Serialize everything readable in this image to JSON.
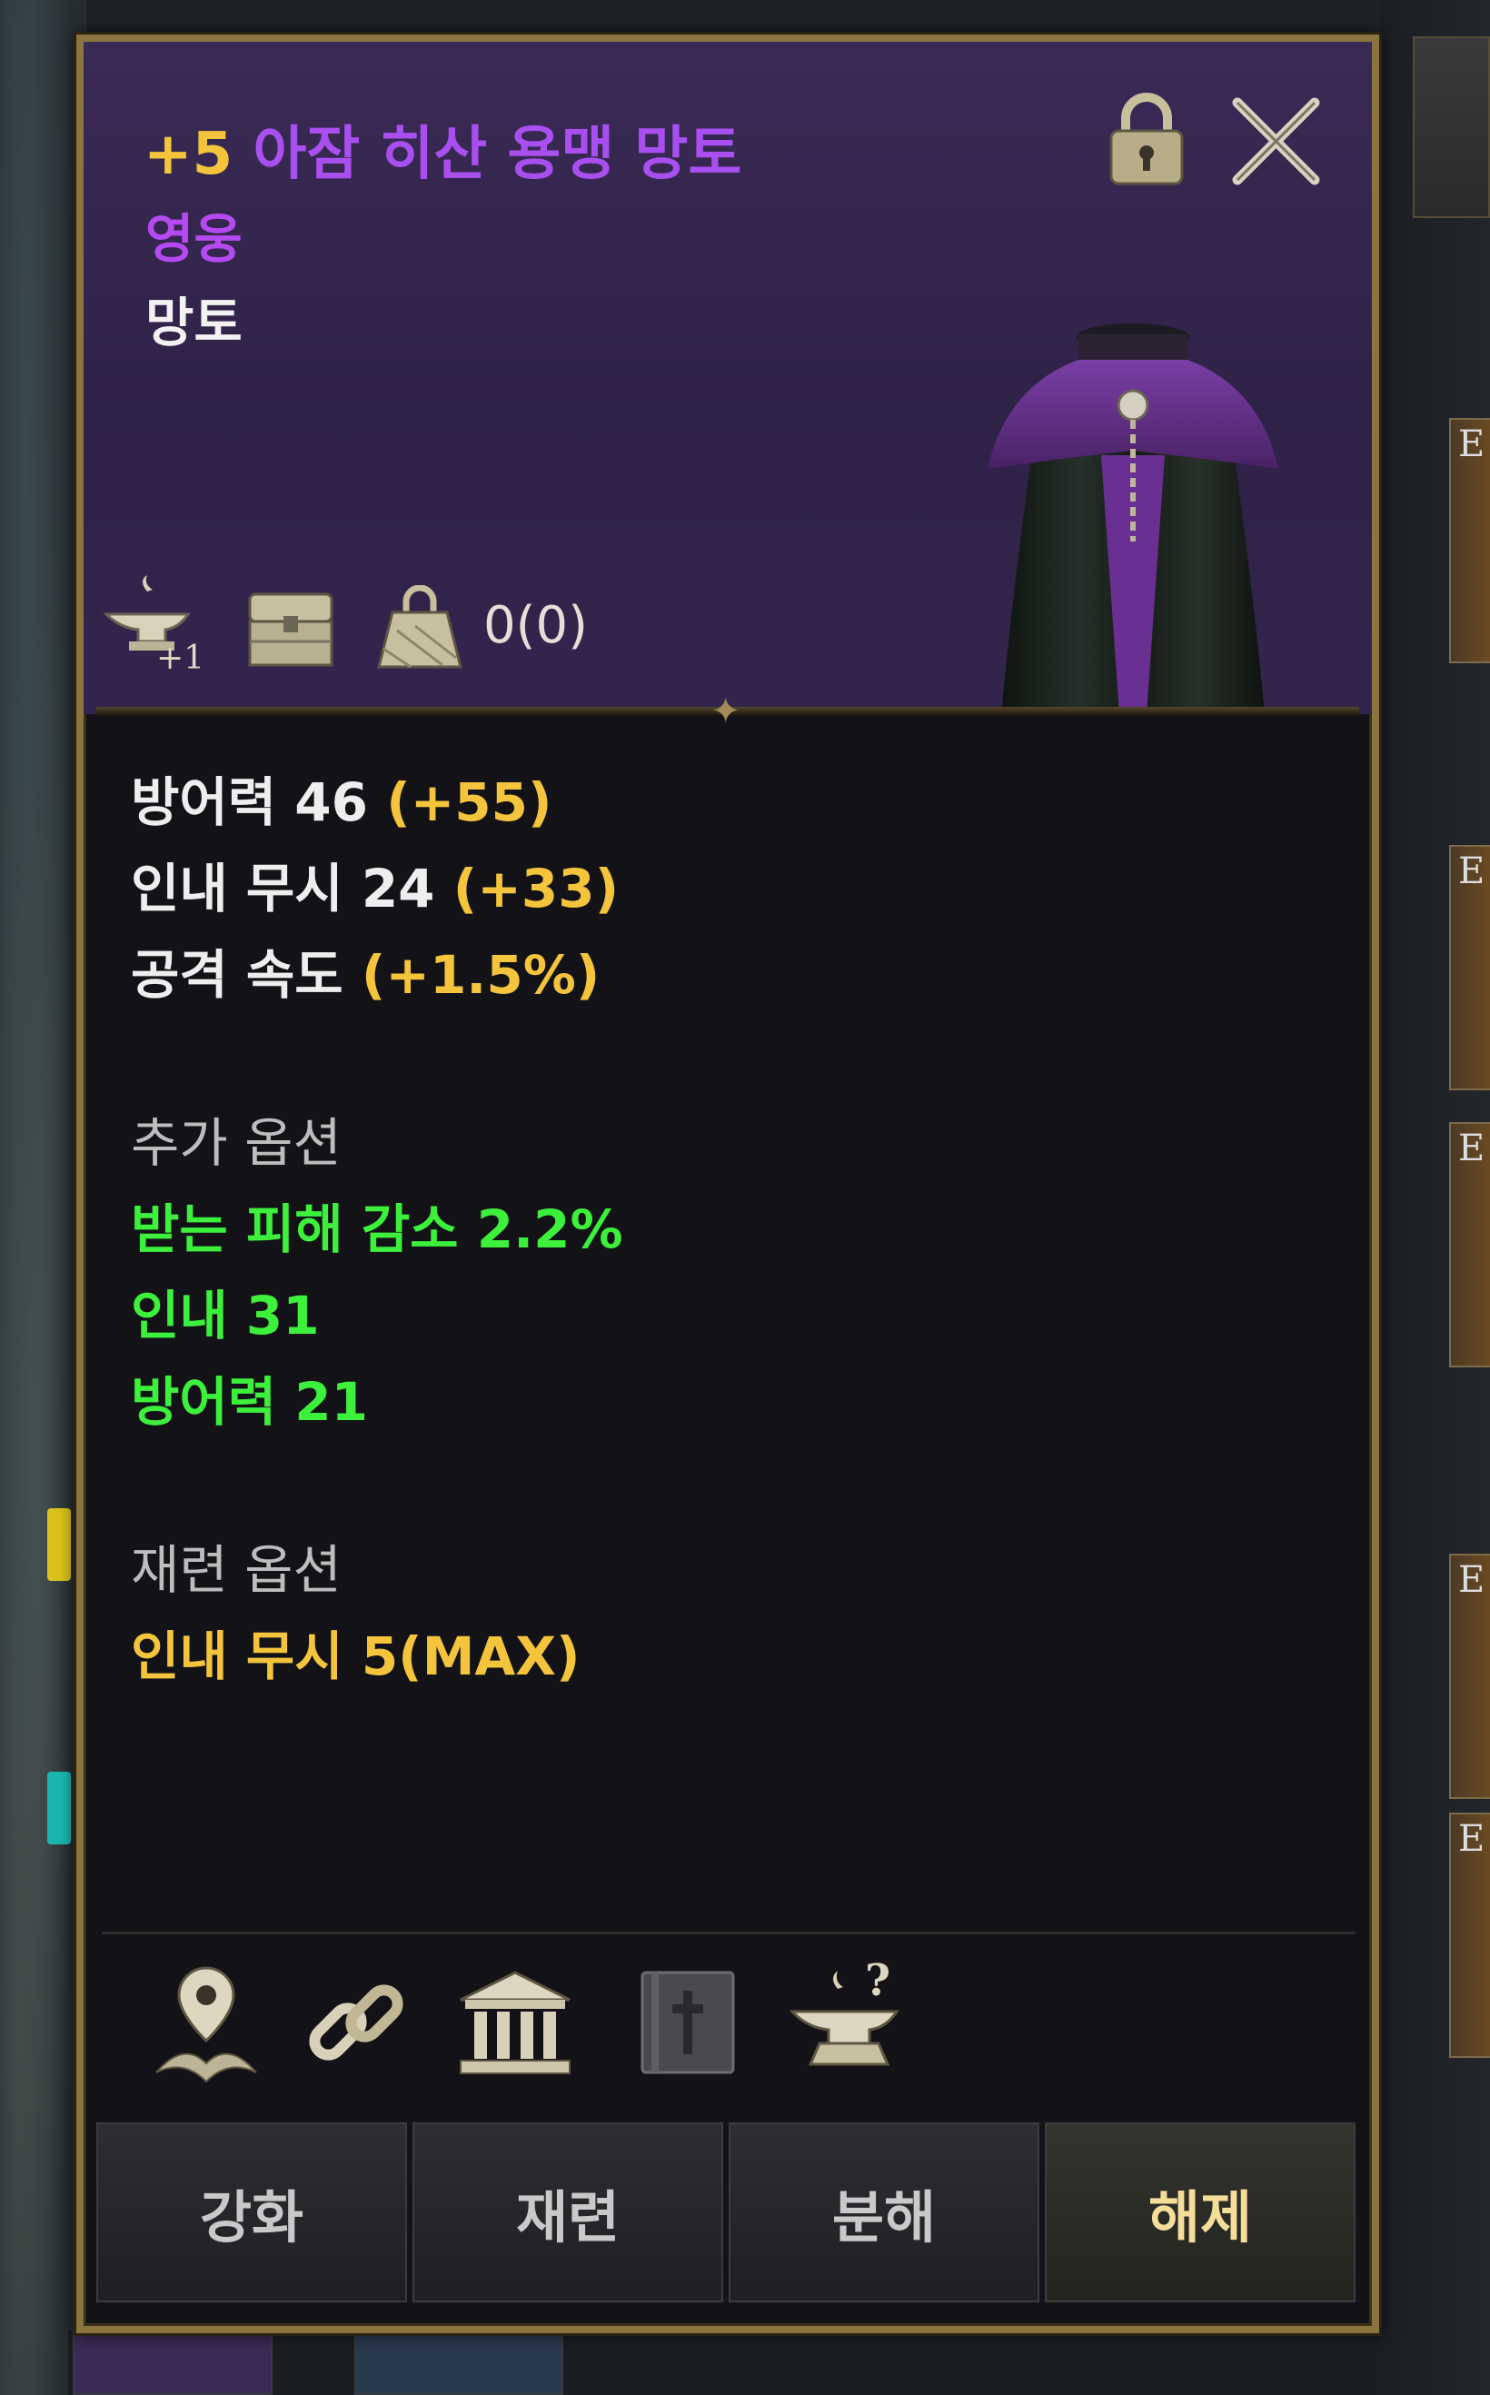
{
  "item": {
    "enhance_level": "+5",
    "name": "아잠 히산 용맹 망토",
    "grade": "영웅",
    "type": "망토",
    "trade_count": "0(0)"
  },
  "header_icons": [
    "anvil-plus-icon",
    "storage-chest-icon",
    "trade-bag-icon"
  ],
  "stats": [
    {
      "label": "방어력 46",
      "bonus": "(+55)"
    },
    {
      "label": "인내 무시 24",
      "bonus": "(+33)"
    },
    {
      "label": "공격 속도",
      "bonus": "(+1.5%)"
    }
  ],
  "additional_options": {
    "heading": "추가 옵션",
    "items": [
      "받는 피해 감소 2.2%",
      "인내 31",
      "방어력 21"
    ]
  },
  "refine_options": {
    "heading": "재련 옵션",
    "items": [
      "인내 무시 5(MAX)"
    ]
  },
  "tool_icons": [
    "location-pin-icon",
    "chain-link-icon",
    "bank-building-icon",
    "book-tome-icon",
    "anvil-question-icon"
  ],
  "buttons": {
    "enhance": "강화",
    "refine": "재련",
    "dismantle": "분해",
    "unequip": "해제"
  },
  "colors": {
    "panel_border": "#8a7440",
    "header_bg": "#33244d",
    "grade_purple": "#b54af2",
    "bonus_gold": "#f3c43c",
    "option_green": "#3cf03c"
  }
}
